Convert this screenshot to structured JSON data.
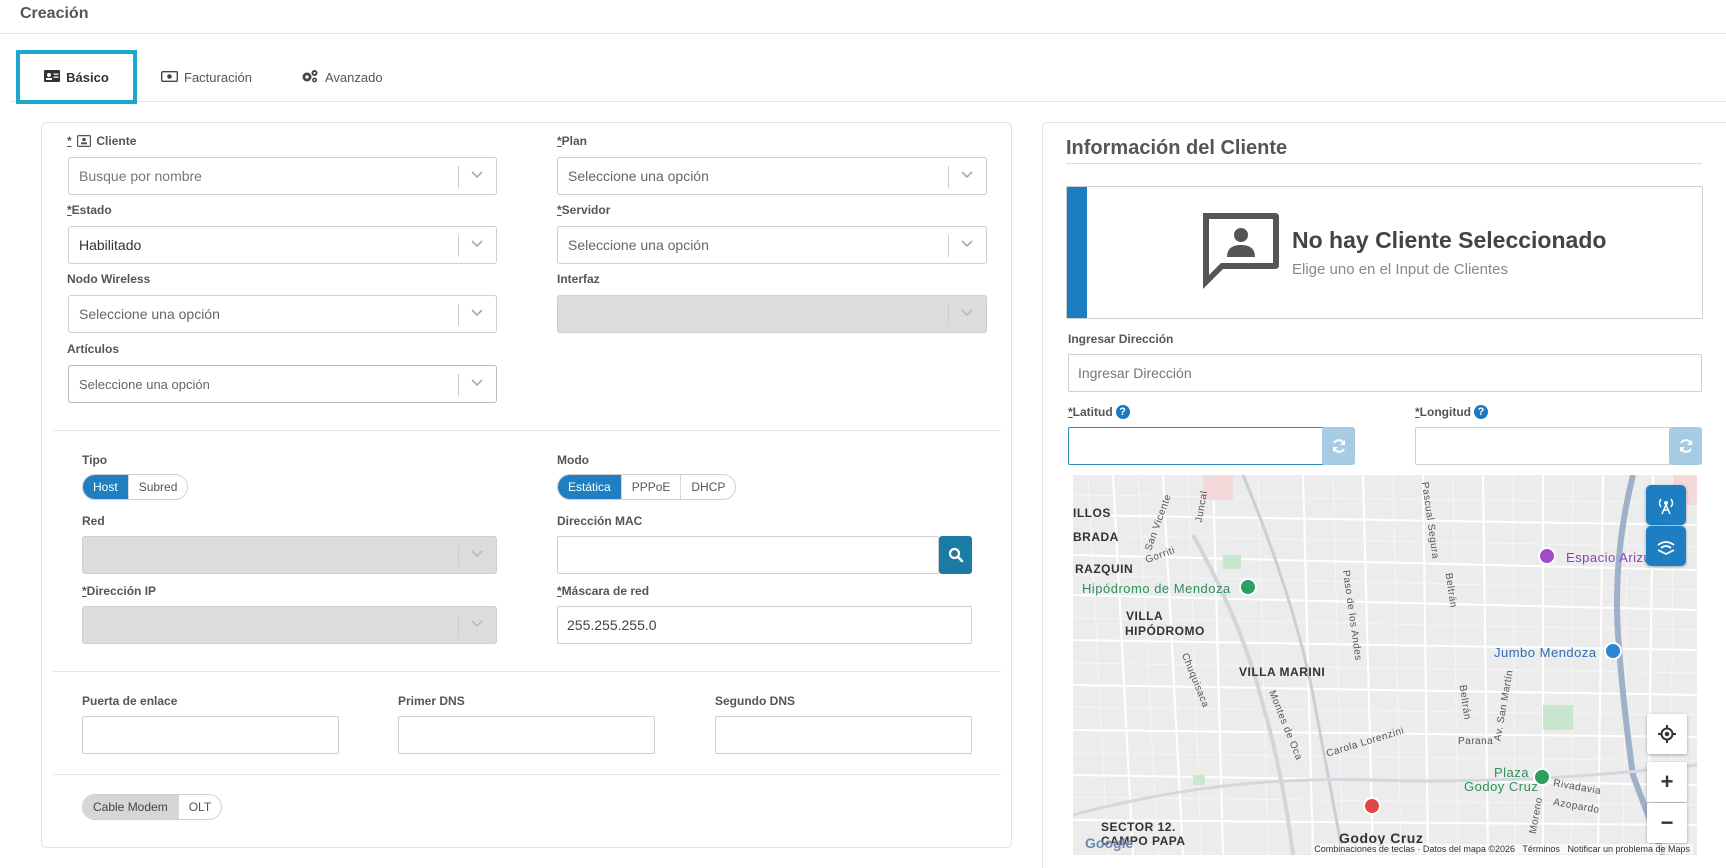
{
  "page": {
    "title": "Creación"
  },
  "tabs": [
    {
      "label": "Básico",
      "icon": "id-card-icon"
    },
    {
      "label": "Facturación",
      "icon": "money-icon"
    },
    {
      "label": "Avanzado",
      "icon": "gears-icon"
    }
  ],
  "form": {
    "cliente": {
      "label": "Cliente",
      "placeholder": "Busque por nombre"
    },
    "plan": {
      "label": "Plan",
      "value": "Seleccione una opción"
    },
    "estado": {
      "label": "Estado",
      "value": "Habilitado"
    },
    "servidor": {
      "label": "Servidor",
      "value": "Seleccione una opción"
    },
    "nodo_wireless": {
      "label": "Nodo Wireless",
      "value": "Seleccione una opción"
    },
    "interfaz": {
      "label": "Interfaz",
      "value": ""
    },
    "articulos": {
      "label": "Artículos",
      "value": "Seleccione una opción"
    },
    "tipo": {
      "label": "Tipo",
      "options": [
        "Host",
        "Subred"
      ],
      "selected": "Host"
    },
    "modo": {
      "label": "Modo",
      "options": [
        "Estática",
        "PPPoE",
        "DHCP"
      ],
      "selected": "Estática"
    },
    "red": {
      "label": "Red",
      "value": ""
    },
    "direccion_mac": {
      "label": "Dirección MAC",
      "value": ""
    },
    "direccion_ip": {
      "label": "Dirección IP",
      "value": ""
    },
    "mascara": {
      "label": "Máscara de red",
      "value": "255.255.255.0"
    },
    "puerta_enlace": {
      "label": "Puerta de enlace",
      "value": ""
    },
    "primer_dns": {
      "label": "Primer DNS",
      "value": ""
    },
    "segundo_dns": {
      "label": "Segundo DNS",
      "value": ""
    },
    "equipo": {
      "options": [
        "Cable Modem",
        "OLT"
      ],
      "selected": "Cable Modem"
    }
  },
  "info": {
    "title": "Información del Cliente",
    "empty_title": "No hay Cliente Seleccionado",
    "empty_subtitle": "Elige uno en el Input de Clientes",
    "address_label": "Ingresar Dirección",
    "address_placeholder": "Ingresar Dirección",
    "latitud_label": "Latitud",
    "longitud_label": "Longitud",
    "latitud_value": "",
    "longitud_value": ""
  },
  "map": {
    "labels": {
      "ilos": "ILLOS",
      "brada": "BRADA",
      "razquin": "RAZQUIN",
      "hipodromo_mendoza": "Hipódromo de Mendoza",
      "villa": "VILLA",
      "hipodromo": "HIPÓDROMO",
      "villa_marini": "VILLA MARINI",
      "espacio": "Espacio Arizu",
      "jumbo": "Jumbo Mendoza",
      "plaza": "Plaza",
      "godoy_cruz_plaza": "Godoy Cruz",
      "sector": "SECTOR 12.",
      "campo_papa": "CAMPO PAPA",
      "godoy_cruz": "Godoy Cruz",
      "rivadavia": "Rivadavia",
      "azopardo": "Azopardo",
      "parana": "Parana",
      "carola": "Carola Lorenzini",
      "san_vicente": "San Vicente",
      "juncal": "Juncal",
      "gorriti": "Gorriti",
      "pascual": "Pascual Segura",
      "beltran": "Beltrán",
      "paso_andes": "Paso de los Andes",
      "chuquisaca": "Chuquisaca",
      "montes_oca": "Montes de Oca",
      "san_martin": "Av. San Martín",
      "moreno": "Moreno",
      "beltran2": "Beltrán"
    },
    "footer": {
      "shortcuts": "Combinaciones de teclas",
      "data": "Datos del mapa ©2026",
      "terms": "Términos",
      "report": "Notificar un problema de Maps"
    },
    "logo": "Google",
    "zoom_in": "+",
    "zoom_out": "−"
  },
  "colors": {
    "accent": "#1f7fc1",
    "tab_border": "#1ba8cc",
    "no_client_bar": "#1b7ec3"
  }
}
